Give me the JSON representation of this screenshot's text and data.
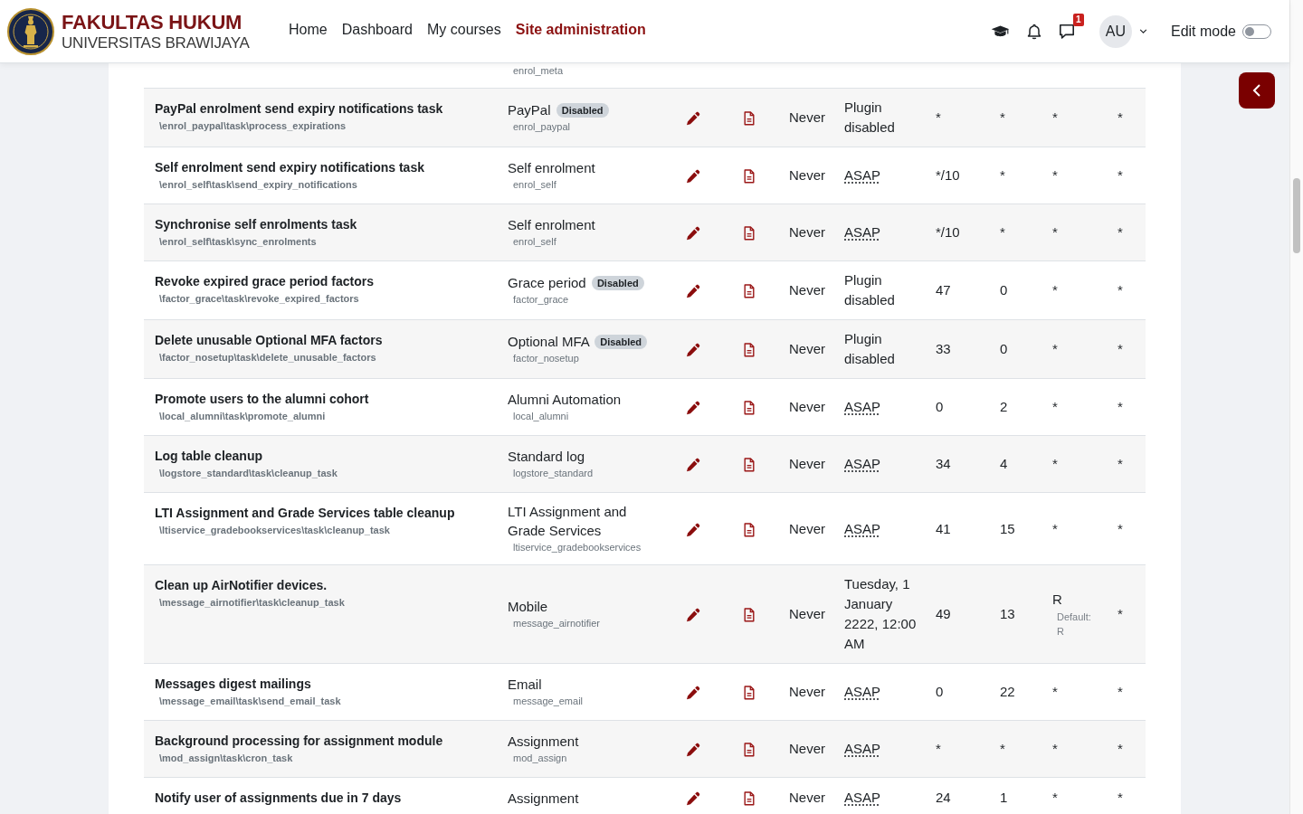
{
  "header": {
    "brand": {
      "title": "FAKULTAS HUKUM",
      "subtitle": "UNIVERSITAS BRAWIJAYA"
    },
    "nav": [
      {
        "label": "Home",
        "selected": false
      },
      {
        "label": "Dashboard",
        "selected": false
      },
      {
        "label": "My courses",
        "selected": false
      },
      {
        "label": "Site administration",
        "selected": true
      }
    ],
    "message_count": "1",
    "avatar_initials": "AU",
    "edit_mode": {
      "label": "Edit mode",
      "on": false
    }
  },
  "table": {
    "rows": [
      {
        "kind": "partial",
        "column_2": {
          "subtitle": "enrol_meta"
        }
      },
      {
        "kind": "task",
        "column_1": {
          "title": "PayPal enrolment send expiry notifications task",
          "subtitle": "\\enrol_paypal\\task\\process_expirations"
        },
        "column_2": {
          "title": "PayPal",
          "badge": "Disabled",
          "subtitle": "enrol_paypal"
        },
        "column_5": "Never",
        "column_6": {
          "text": "Plugin disabled",
          "kind": "text"
        },
        "column_7": "*",
        "column_8": "*",
        "column_9": {
          "text": "*",
          "highlighted": false
        },
        "column_10": "*"
      },
      {
        "kind": "task",
        "column_1": {
          "title": "Self enrolment send expiry notifications task",
          "subtitle": "\\enrol_self\\task\\send_expiry_notifications"
        },
        "column_2": {
          "title": "Self enrolment",
          "subtitle": "enrol_self"
        },
        "column_5": "Never",
        "column_6": {
          "text": "ASAP",
          "kind": "abbr"
        },
        "column_7": "*/10",
        "column_8": "*",
        "column_9": {
          "text": "*",
          "highlighted": false
        },
        "column_10": "*"
      },
      {
        "kind": "task",
        "column_1": {
          "title": "Synchronise self enrolments task",
          "subtitle": "\\enrol_self\\task\\sync_enrolments"
        },
        "column_2": {
          "title": "Self enrolment",
          "subtitle": "enrol_self"
        },
        "column_5": "Never",
        "column_6": {
          "text": "ASAP",
          "kind": "abbr"
        },
        "column_7": "*/10",
        "column_8": "*",
        "column_9": {
          "text": "*",
          "highlighted": false
        },
        "column_10": "*"
      },
      {
        "kind": "task",
        "column_1": {
          "title": "Revoke expired grace period factors",
          "subtitle": "\\factor_grace\\task\\revoke_expired_factors"
        },
        "column_2": {
          "title": "Grace period",
          "badge": "Disabled",
          "subtitle": "factor_grace"
        },
        "column_5": "Never",
        "column_6": {
          "text": "Plugin disabled",
          "kind": "text"
        },
        "column_7": "47",
        "column_8": "0",
        "column_9": {
          "text": "*",
          "highlighted": false
        },
        "column_10": "*"
      },
      {
        "kind": "task",
        "column_1": {
          "title": "Delete unusable Optional MFA factors",
          "subtitle": "\\factor_nosetup\\task\\delete_unusable_factors"
        },
        "column_2": {
          "title": "Optional MFA",
          "badge": "Disabled",
          "subtitle": "factor_nosetup"
        },
        "column_5": "Never",
        "column_6": {
          "text": "Plugin disabled",
          "kind": "text"
        },
        "column_7": "33",
        "column_8": "0",
        "column_9": {
          "text": "*",
          "highlighted": false
        },
        "column_10": "*"
      },
      {
        "kind": "task",
        "column_1": {
          "title": "Promote users to the alumni cohort",
          "subtitle": "\\local_alumni\\task\\promote_alumni"
        },
        "column_2": {
          "title": "Alumni Automation",
          "subtitle": "local_alumni"
        },
        "column_5": "Never",
        "column_6": {
          "text": "ASAP",
          "kind": "abbr"
        },
        "column_7": "0",
        "column_8": "2",
        "column_9": {
          "text": "*",
          "highlighted": false
        },
        "column_10": "*"
      },
      {
        "kind": "task",
        "column_1": {
          "title": "Log table cleanup",
          "subtitle": "\\logstore_standard\\task\\cleanup_task"
        },
        "column_2": {
          "title": "Standard log",
          "subtitle": "logstore_standard"
        },
        "column_5": "Never",
        "column_6": {
          "text": "ASAP",
          "kind": "abbr"
        },
        "column_7": "34",
        "column_8": "4",
        "column_9": {
          "text": "*",
          "highlighted": false
        },
        "column_10": "*"
      },
      {
        "kind": "task",
        "column_1": {
          "title": "LTI Assignment and Grade Services table cleanup",
          "subtitle": "\\ltiservice_gradebookservices\\task\\cleanup_task"
        },
        "column_2": {
          "title": "LTI Assignment and Grade Services",
          "subtitle": "ltiservice_gradebookservices"
        },
        "column_5": "Never",
        "column_6": {
          "text": "ASAP",
          "kind": "abbr"
        },
        "column_7": "41",
        "column_8": "15",
        "column_9": {
          "text": "*",
          "highlighted": false
        },
        "column_10": "*"
      },
      {
        "kind": "task",
        "column_1": {
          "title": "Clean up AirNotifier devices.",
          "subtitle": "\\message_airnotifier\\task\\cleanup_task"
        },
        "column_2": {
          "title": "Mobile",
          "subtitle": "message_airnotifier"
        },
        "column_5": "Never",
        "column_6": {
          "text": "Tuesday, 1 January 2222, 12:00 AM",
          "kind": "text"
        },
        "column_7": "49",
        "column_8": "13",
        "column_9": {
          "text": "R",
          "highlighted": true,
          "note": "Default: R"
        },
        "column_10": "*"
      },
      {
        "kind": "task",
        "column_1": {
          "title": "Messages digest mailings",
          "subtitle": "\\message_email\\task\\send_email_task"
        },
        "column_2": {
          "title": "Email",
          "subtitle": "message_email"
        },
        "column_5": "Never",
        "column_6": {
          "text": "ASAP",
          "kind": "abbr"
        },
        "column_7": "0",
        "column_8": "22",
        "column_9": {
          "text": "*",
          "highlighted": false
        },
        "column_10": "*"
      },
      {
        "kind": "task",
        "column_1": {
          "title": "Background processing for assignment module",
          "subtitle": "\\mod_assign\\task\\cron_task"
        },
        "column_2": {
          "title": "Assignment",
          "subtitle": "mod_assign"
        },
        "column_5": "Never",
        "column_6": {
          "text": "ASAP",
          "kind": "abbr"
        },
        "column_7": "*",
        "column_8": "*",
        "column_9": {
          "text": "*",
          "highlighted": false
        },
        "column_10": "*"
      },
      {
        "kind": "task",
        "column_1": {
          "title": "Notify user of assignments due in 7 days"
        },
        "column_2": {
          "title": "Assignment"
        },
        "column_5": "Never",
        "column_6": {
          "text": "ASAP",
          "kind": "abbr"
        },
        "column_7": "24",
        "column_8": "1",
        "column_9": {
          "text": "*",
          "highlighted": false
        },
        "column_10": "*"
      }
    ]
  }
}
